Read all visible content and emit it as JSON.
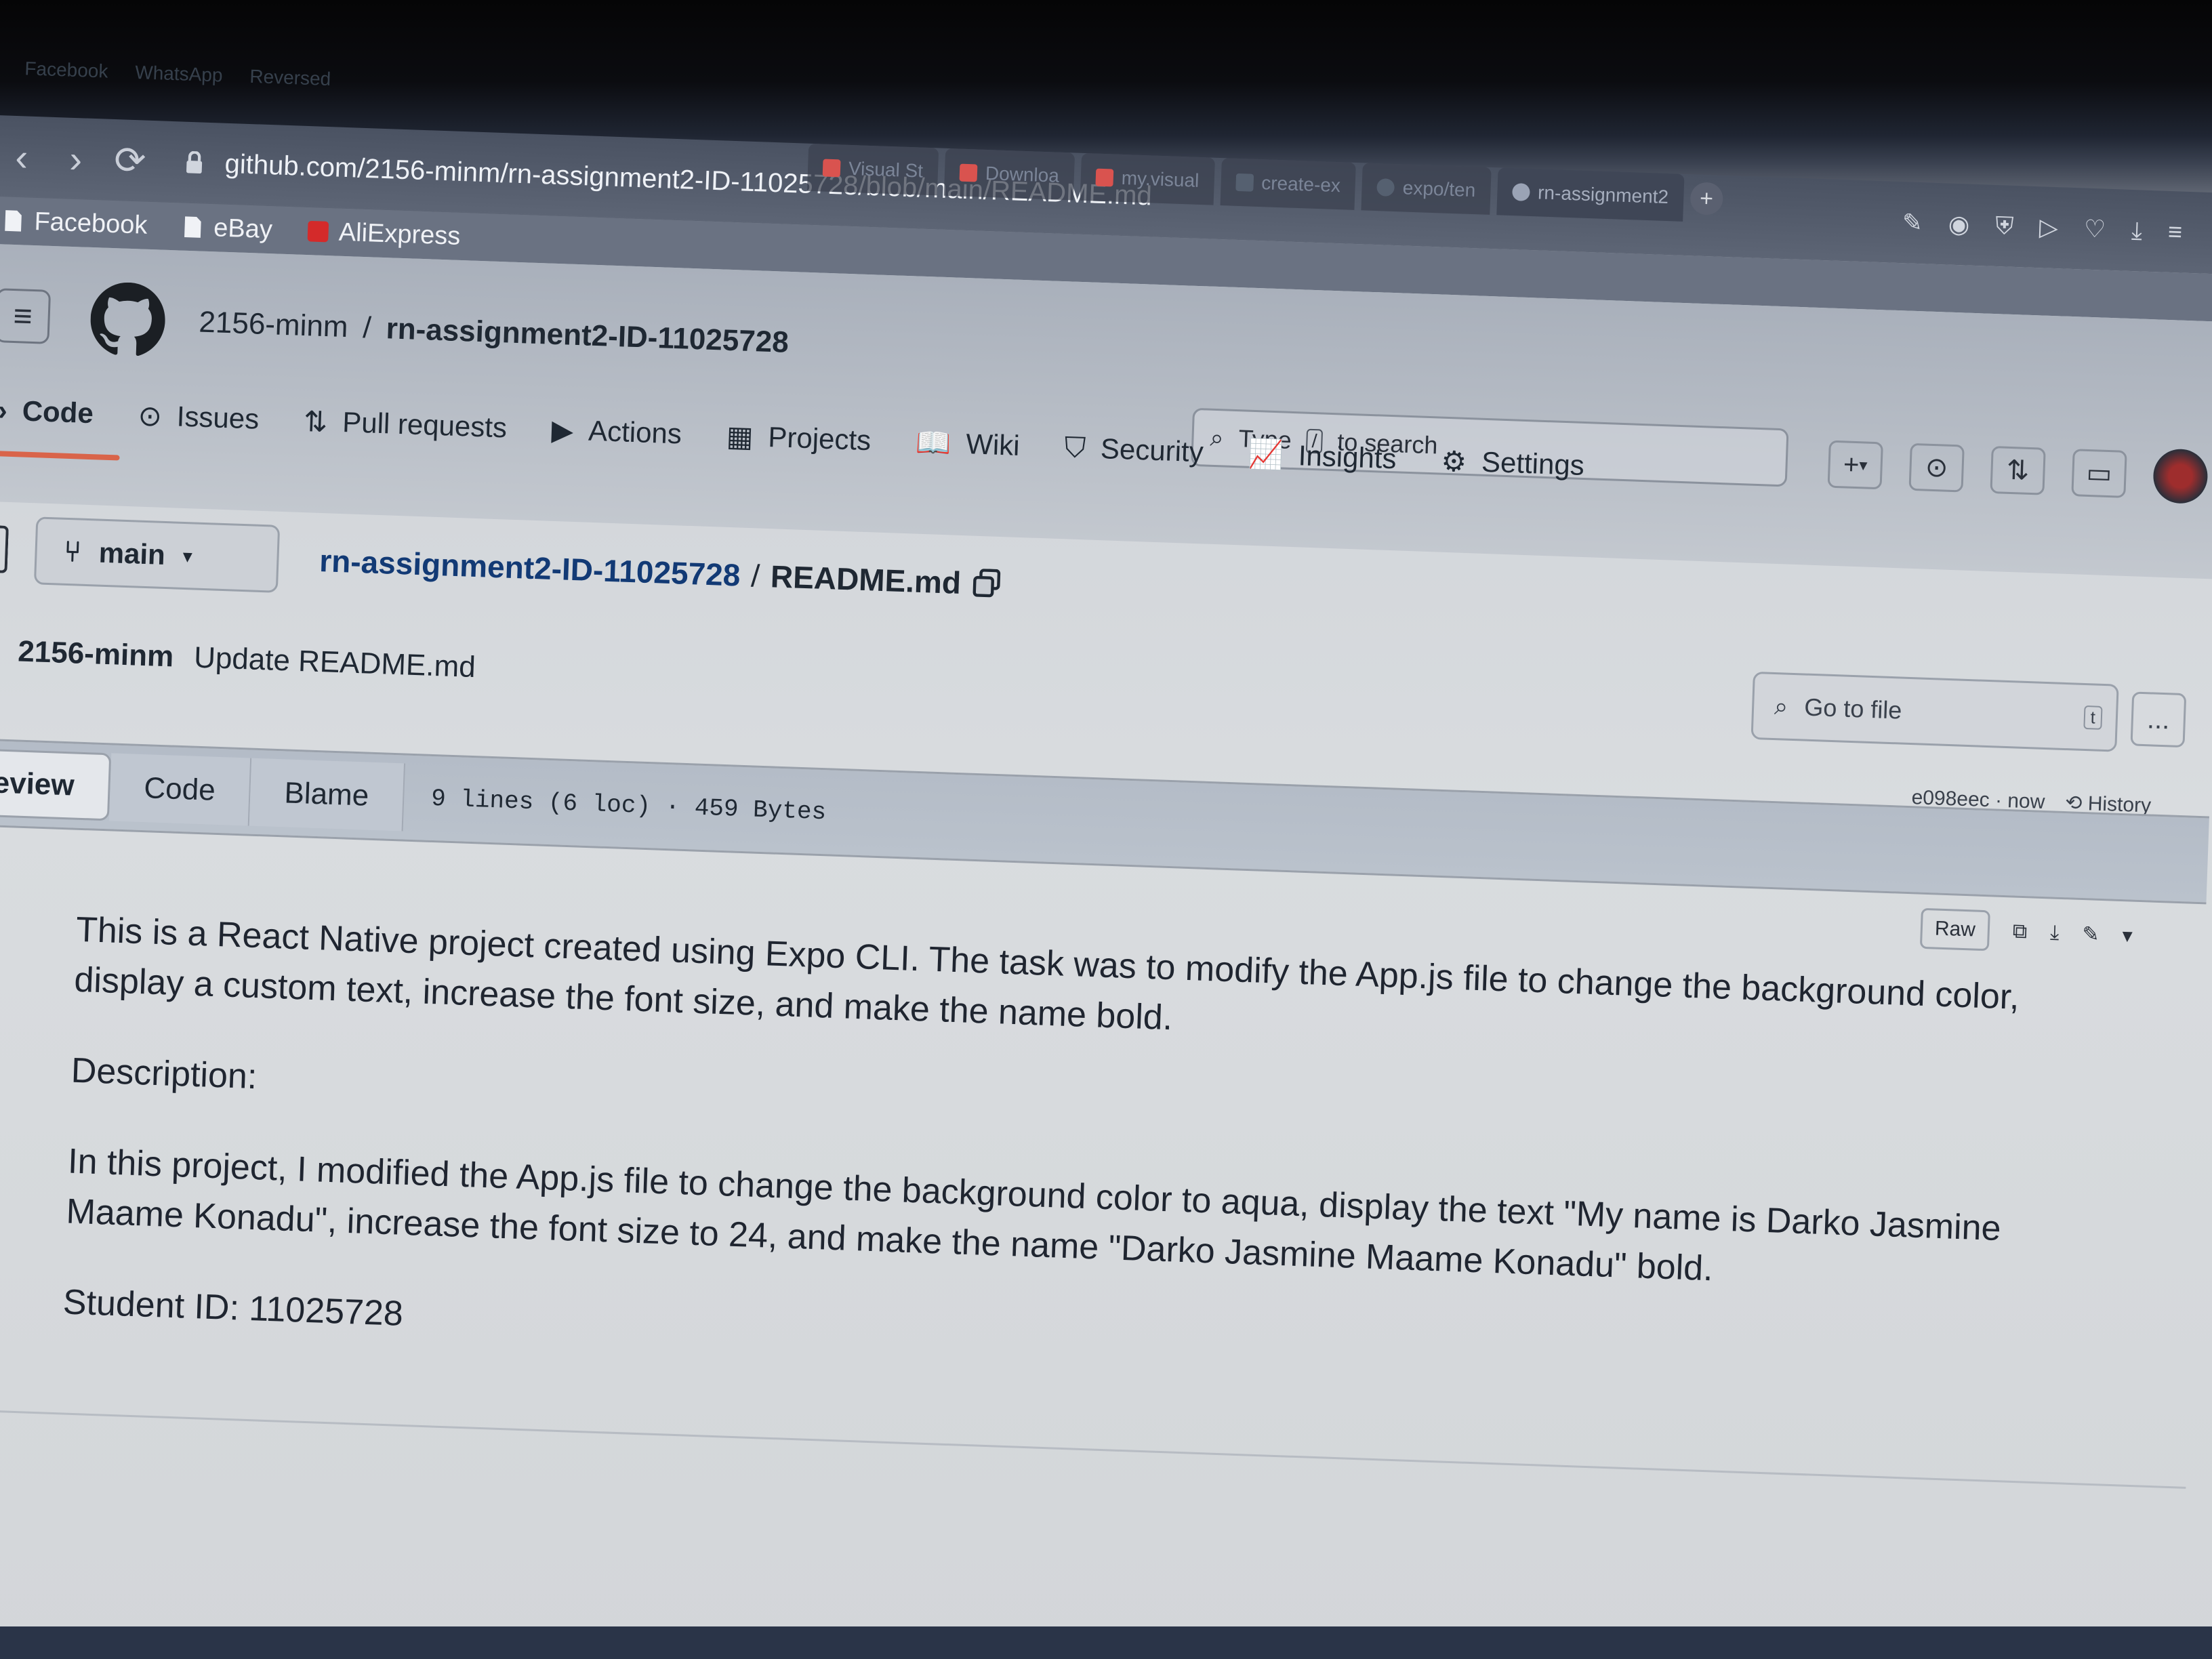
{
  "taskbar": {
    "items": [
      "Facebook",
      "WhatsApp",
      "Reversed"
    ]
  },
  "browser": {
    "tabs": [
      {
        "label": "Visual St",
        "color": "#d9534f"
      },
      {
        "label": "Downloa",
        "color": "#d9534f"
      },
      {
        "label": "my.visual",
        "color": "#d9534f"
      },
      {
        "label": "create-ex",
        "color": "#556070"
      },
      {
        "label": "expo/ten",
        "color": "#556070"
      },
      {
        "label": "rn-assignment2",
        "color": "#556070"
      }
    ],
    "new_tab": "+",
    "url": "github.com/2156-minm/rn-assignment2-ID-11025728/blob/main/README.md",
    "bookmarks": [
      "Facebook",
      "eBay",
      "AliExpress"
    ]
  },
  "github": {
    "owner": "2156-minm",
    "separator": "/",
    "repo": "rn-assignment2-ID-11025728",
    "search_placeholder_pre": "Type",
    "search_key": "/",
    "search_placeholder_post": "to search",
    "add_button": "+",
    "repo_tabs": [
      {
        "label": "Code",
        "icon": "code-icon"
      },
      {
        "label": "Issues",
        "icon": "issues-icon"
      },
      {
        "label": "Pull requests",
        "icon": "pull-request-icon"
      },
      {
        "label": "Actions",
        "icon": "actions-icon"
      },
      {
        "label": "Projects",
        "icon": "projects-icon"
      },
      {
        "label": "Wiki",
        "icon": "wiki-icon"
      },
      {
        "label": "Security",
        "icon": "security-icon"
      },
      {
        "label": "Insights",
        "icon": "insights-icon"
      },
      {
        "label": "Settings",
        "icon": "settings-icon"
      }
    ],
    "branch": "main",
    "breadcrumb_repo": "rn-assignment2-ID-11025728",
    "breadcrumb_sep": "/",
    "file_name": "README.md",
    "commit_author": "2156-minm",
    "commit_message": "Update README.md",
    "goto_file": "Go to file",
    "goto_key": "t",
    "more": "...",
    "commit_hash": "e098eec · now",
    "history": "History",
    "view_tabs": [
      "review",
      "Code",
      "Blame"
    ],
    "file_info": "9 lines (6 loc) · 459 Bytes",
    "raw": "Raw"
  },
  "readme": {
    "intro": "This is a React Native project created using Expo CLI. The task was to modify the App.js file to change the background color, display a custom text, increase the font size, and make the name bold.",
    "description_label": "Description:",
    "description": "In this project, I modified the App.js file to change the background color to aqua, display the text \"My name is Darko Jasmine Maame Konadu\", increase the font size to 24, and make the name \"Darko Jasmine Maame Konadu\" bold.",
    "student_id": "Student ID: 11025728"
  },
  "colors": {
    "accent_underline": "#d9644a",
    "link": "#123a75"
  }
}
